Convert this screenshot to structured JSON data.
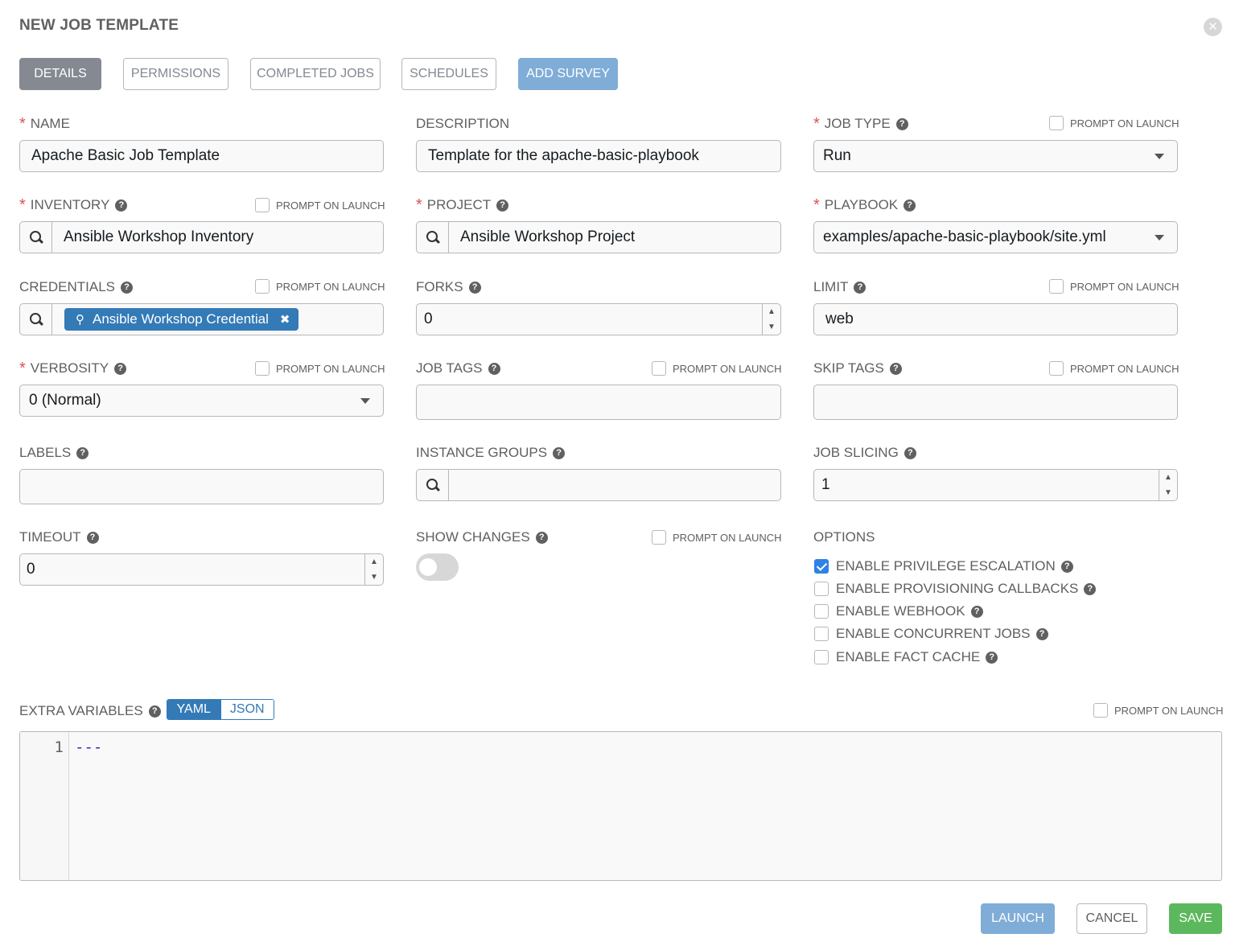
{
  "header": {
    "title": "NEW JOB TEMPLATE",
    "close_glyph": "✕"
  },
  "tabs": {
    "details": "DETAILS",
    "permissions": "PERMISSIONS",
    "completed_jobs": "COMPLETED JOBS",
    "schedules": "SCHEDULES",
    "add_survey": "ADD SURVEY"
  },
  "common": {
    "required_mark": "*",
    "help_glyph": "?",
    "prompt_on_launch": "PROMPT ON LAUNCH"
  },
  "fields": {
    "name": {
      "label": "NAME",
      "value": "Apache Basic Job Template"
    },
    "description": {
      "label": "DESCRIPTION",
      "value": "Template for the apache-basic-playbook"
    },
    "job_type": {
      "label": "JOB TYPE",
      "value": "Run"
    },
    "inventory": {
      "label": "INVENTORY",
      "value": "Ansible Workshop Inventory"
    },
    "project": {
      "label": "PROJECT",
      "value": "Ansible Workshop Project"
    },
    "playbook": {
      "label": "PLAYBOOK",
      "value": "examples/apache-basic-playbook/site.yml"
    },
    "credentials": {
      "label": "CREDENTIALS",
      "chip": "Ansible Workshop Credential",
      "chip_remove": "✖"
    },
    "forks": {
      "label": "FORKS",
      "value": "0"
    },
    "limit": {
      "label": "LIMIT",
      "value": "web"
    },
    "verbosity": {
      "label": "VERBOSITY",
      "value": "0 (Normal)"
    },
    "job_tags": {
      "label": "JOB TAGS",
      "value": ""
    },
    "skip_tags": {
      "label": "SKIP TAGS",
      "value": ""
    },
    "labels": {
      "label": "LABELS",
      "value": ""
    },
    "instance_groups": {
      "label": "INSTANCE GROUPS",
      "value": ""
    },
    "job_slicing": {
      "label": "JOB SLICING",
      "value": "1"
    },
    "timeout": {
      "label": "TIMEOUT",
      "value": "0"
    },
    "show_changes": {
      "label": "SHOW CHANGES",
      "enabled": false
    }
  },
  "spinner": {
    "up": "▲",
    "down": "▼"
  },
  "options": {
    "label": "OPTIONS",
    "items": [
      {
        "label": "ENABLE PRIVILEGE ESCALATION",
        "checked": true
      },
      {
        "label": "ENABLE PROVISIONING CALLBACKS",
        "checked": false
      },
      {
        "label": "ENABLE WEBHOOK",
        "checked": false
      },
      {
        "label": "ENABLE CONCURRENT JOBS",
        "checked": false
      },
      {
        "label": "ENABLE FACT CACHE",
        "checked": false
      }
    ]
  },
  "extra_vars": {
    "label": "EXTRA VARIABLES",
    "yaml": "YAML",
    "json": "JSON",
    "line_number": "1",
    "code": "---"
  },
  "buttons": {
    "launch": "LAUNCH",
    "cancel": "CANCEL",
    "save": "SAVE"
  },
  "colors": {
    "primary": "#337ab7",
    "success": "#5cb85c",
    "danger": "#d9534f",
    "muted_blue": "#7fadd7"
  }
}
